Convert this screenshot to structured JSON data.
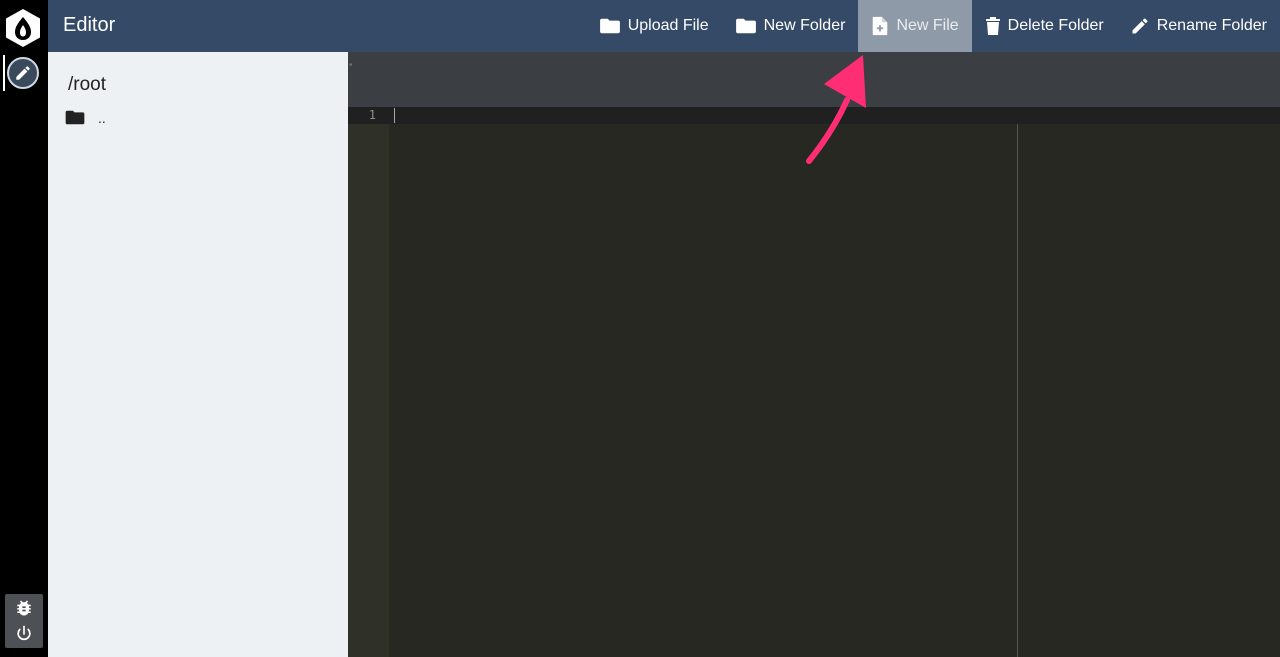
{
  "header": {
    "title": "Editor"
  },
  "toolbar": {
    "items": [
      {
        "label": "Upload File",
        "icon": "folder-icon"
      },
      {
        "label": "New Folder",
        "icon": "folder-icon"
      },
      {
        "label": "New File",
        "icon": "new-file-icon",
        "active": true
      },
      {
        "label": "Delete Folder",
        "icon": "trash-icon"
      },
      {
        "label": "Rename Folder",
        "icon": "pencil-icon"
      }
    ]
  },
  "file_panel": {
    "path": "/root",
    "entries": [
      {
        "name": "..",
        "icon": "folder-icon"
      }
    ]
  },
  "editor": {
    "line_numbers": [
      "1"
    ]
  },
  "colors": {
    "header_bg": "#344a67",
    "active_tool_bg": "#8f9aa8",
    "annotation_arrow": "#ff2d73",
    "editor_bg": "#272822"
  }
}
